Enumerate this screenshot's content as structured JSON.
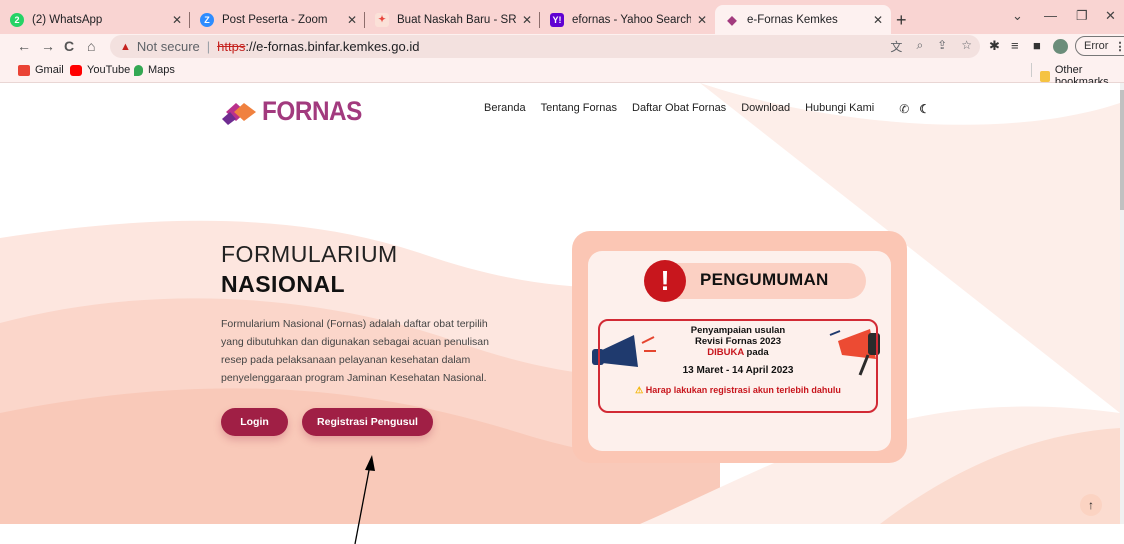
{
  "tabs": [
    {
      "title": "(2) WhatsApp",
      "icon": "whatsapp-icon",
      "color": "#25d366"
    },
    {
      "title": "Post Peserta - Zoom",
      "icon": "zoom-icon",
      "color": "#2d8cff"
    },
    {
      "title": "Buat Naskah Baru - SRIKANDI",
      "icon": "srikandi-icon",
      "color": "#e8453c"
    },
    {
      "title": "efornas - Yahoo Search Results",
      "icon": "yahoo-icon",
      "color": "#6001d2"
    },
    {
      "title": "e-Fornas Kemkes",
      "icon": "fornas-icon",
      "color": "#a23a7e"
    }
  ],
  "omnibox": {
    "security": "Not secure",
    "scheme": "https",
    "url_rest": "://e-fornas.binfar.kemkes.go.id"
  },
  "profile": {
    "error_label": "Error"
  },
  "bookmarks": {
    "items": [
      {
        "label": "Gmail",
        "color": "#ea4335"
      },
      {
        "label": "YouTube",
        "color": "#ff0000"
      },
      {
        "label": "Maps",
        "color": "#34a853"
      }
    ],
    "other": "Other bookmarks"
  },
  "site": {
    "logo_text": "FORNAS",
    "nav": [
      "Beranda",
      "Tentang Fornas",
      "Daftar Obat Fornas",
      "Download",
      "Hubungi Kami"
    ]
  },
  "hero": {
    "title_line1": "FORMULARIUM",
    "title_line2": "NASIONAL",
    "description": "Formularium Nasional (Fornas) adalah daftar obat terpilih yang dibutuhkan dan digunakan sebagai acuan penulisan resep pada pelaksanaan pelayanan kesehatan dalam penyelenggaraan program Jaminan Kesehatan Nasional.",
    "login_label": "Login",
    "register_label": "Registrasi Pengusul"
  },
  "announcement": {
    "heading": "PENGUMUMAN",
    "line1": "Penyampaian usulan",
    "line2": "Revisi Fornas 2023",
    "line3a": "DIBUKA",
    "line3b": " pada",
    "dates": "13 Maret - 14 April 2023",
    "warning": "Harap lakukan registrasi akun terlebih dahulu"
  },
  "colors": {
    "primary_button": "#a01f45",
    "brand": "#a23a7e",
    "accent_red": "#c8161d"
  }
}
